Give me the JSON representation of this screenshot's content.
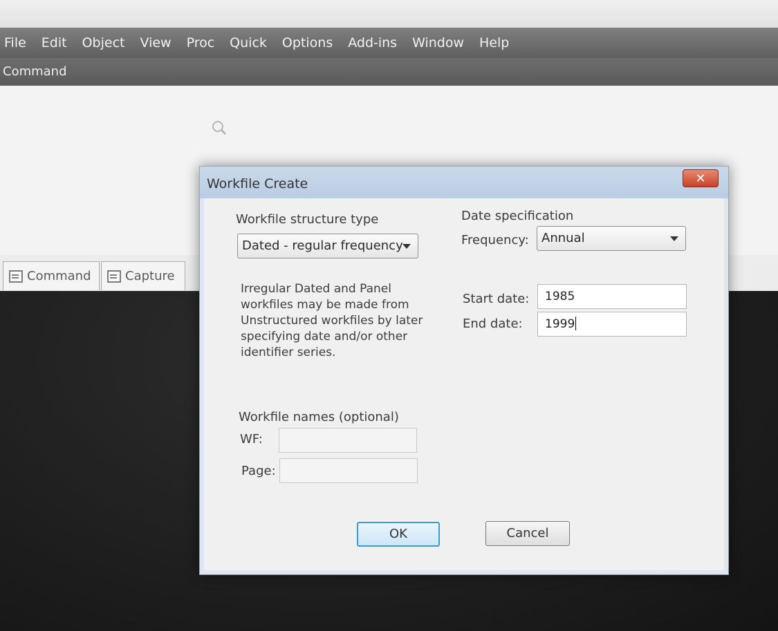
{
  "menubar": {
    "items": [
      "File",
      "Edit",
      "Object",
      "View",
      "Proc",
      "Quick",
      "Options",
      "Add-ins",
      "Window",
      "Help"
    ]
  },
  "command_window": {
    "header": "Command",
    "zoom_icon": "magnifier-icon"
  },
  "tabs": [
    {
      "label": "Command",
      "icon": "window-icon"
    },
    {
      "label": "Capture",
      "icon": "window-icon"
    }
  ],
  "dialog": {
    "title": "Workfile Create",
    "close_glyph": "✕",
    "structure": {
      "heading": "Workfile structure type",
      "selected": "Dated - regular frequency",
      "note": "Irregular Dated and Panel workfiles may be made from Unstructured workfiles by later specifying date and/or other identifier series."
    },
    "date_spec": {
      "heading": "Date specification",
      "frequency_label": "Frequency:",
      "frequency_value": "Annual",
      "start_label": "Start date:",
      "start_value": "1985",
      "end_label": "End date:",
      "end_value": "1999"
    },
    "names": {
      "heading": "Workfile names (optional)",
      "wf_label": "WF:",
      "wf_value": "",
      "page_label": "Page:",
      "page_value": ""
    },
    "buttons": {
      "ok": "OK",
      "cancel": "Cancel"
    }
  },
  "colors": {
    "menubar": "#6f6f6f",
    "dialog_title": "#c3d5e8",
    "close_button": "#d4533b",
    "default_button_border": "#3c9bd7"
  }
}
